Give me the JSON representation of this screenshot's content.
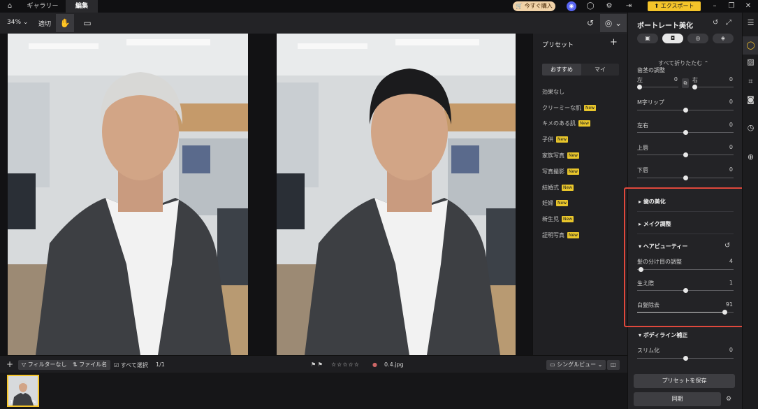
{
  "titlebar": {
    "tabs": [
      {
        "label": "ギャラリー"
      },
      {
        "label": "編集"
      }
    ],
    "buy_label": "今すぐ購入",
    "export_label": "エクスポート",
    "accent_color": "#f4c42a"
  },
  "toolbar": {
    "zoom": "34%",
    "fit_label": "適切"
  },
  "presets": {
    "title": "プリセット",
    "add_icon": "+",
    "tabs": [
      "おすすめ",
      "マイ"
    ],
    "new_badge": "New",
    "items": [
      {
        "label": "効果なし",
        "new": false
      },
      {
        "label": "クリーミーな肌",
        "new": true
      },
      {
        "label": "キメのある肌",
        "new": true
      },
      {
        "label": "子供",
        "new": true
      },
      {
        "label": "家族写真",
        "new": true
      },
      {
        "label": "写真撮影",
        "new": true
      },
      {
        "label": "結婚式",
        "new": true
      },
      {
        "label": "妊婦",
        "new": true
      },
      {
        "label": "新生児",
        "new": true
      },
      {
        "label": "証明写真",
        "new": true
      }
    ]
  },
  "panel": {
    "title": "ポートレート美化",
    "collapse_all": "すべて折りたたむ",
    "hairline_section": "歯茎の調整",
    "sliders_top": [
      {
        "label": "左",
        "value": "0",
        "level": 0.0
      },
      {
        "label": "右",
        "value": "0",
        "level": 0.0
      },
      {
        "label": "M字リップ",
        "value": "0",
        "level": 0.5
      },
      {
        "label": "左右",
        "value": "0",
        "level": 0.5
      },
      {
        "label": "上唇",
        "value": "0",
        "level": 0.5
      },
      {
        "label": "下唇",
        "value": "0",
        "level": 0.5
      }
    ],
    "sections": [
      {
        "label": "歯の美化"
      },
      {
        "label": "メイク調整"
      },
      {
        "label": "ヘアビューティー"
      }
    ],
    "hair_sliders": [
      {
        "label": "髪の分け目の調整",
        "value": "4",
        "level": 0.04
      },
      {
        "label": "生え際",
        "value": "1",
        "level": 0.5
      },
      {
        "label": "白髪除去",
        "value": "91",
        "level": 0.91
      }
    ],
    "body_section": "ボディライン補正",
    "body_sliders": [
      {
        "label": "スリム化",
        "value": "0",
        "level": 0.5
      }
    ],
    "save_preset": "プリセットを保存",
    "sync": "同期"
  },
  "bottombar": {
    "filter_label": "フィルターなし",
    "filename_label": "ファイル名",
    "select_all": "すべて選択",
    "count": "1/1",
    "stars": "☆☆☆☆☆",
    "filename": "0.4.jpg",
    "view_label": "シングルビュー"
  },
  "filmstrip": {
    "index": "1"
  }
}
